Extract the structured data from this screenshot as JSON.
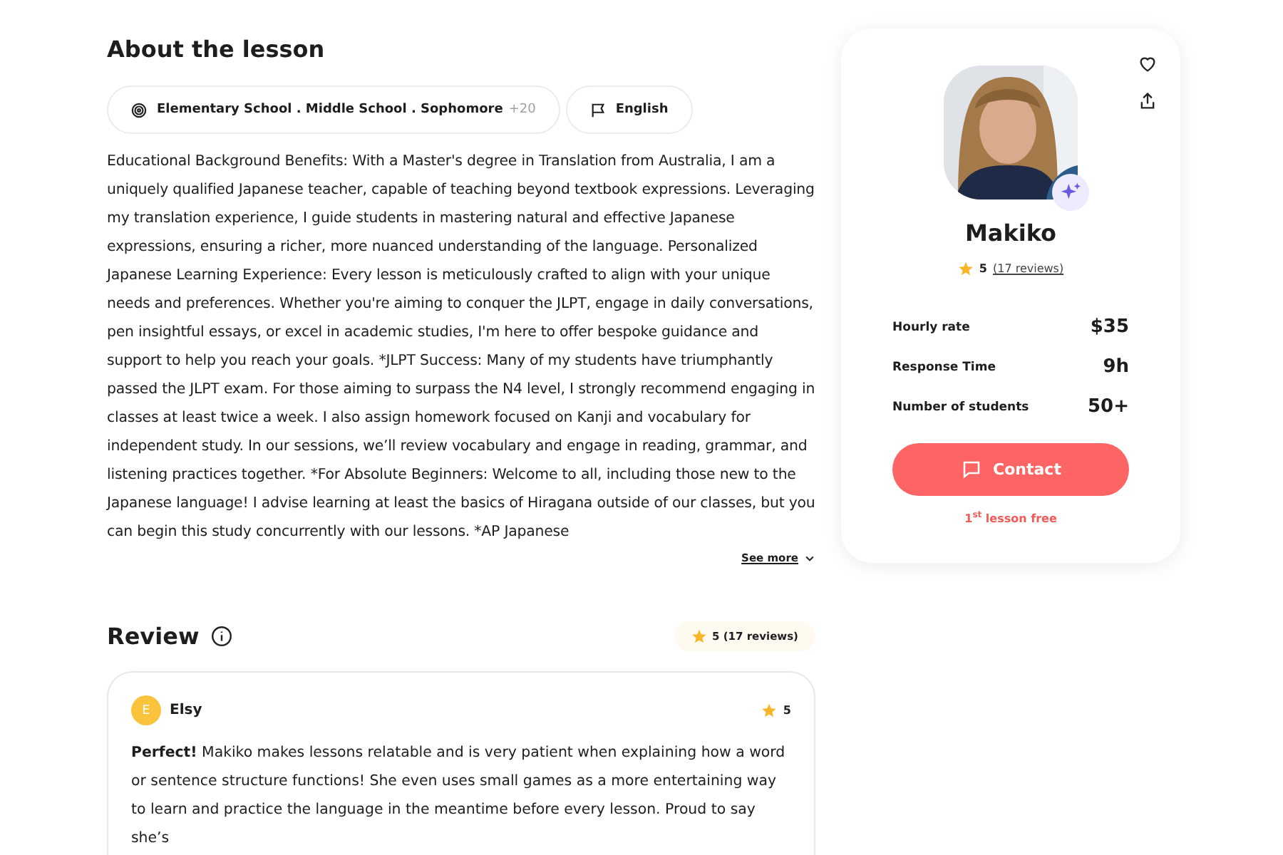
{
  "about": {
    "title": "About the lesson",
    "tags": [
      {
        "kind": "levels",
        "label": "Elementary School . Middle School . Sophomore",
        "extra": "+20"
      },
      {
        "kind": "language",
        "label": "English"
      }
    ],
    "description": "Educational Background Benefits: With a Master's degree in Translation from Australia, I am a uniquely qualified Japanese teacher, capable of teaching beyond textbook expressions. Leveraging my translation experience, I guide students in mastering natural and effective Japanese expressions, ensuring a richer, more nuanced understanding of the language. Personalized Japanese Learning Experience: Every lesson is meticulously crafted to align with your unique needs and preferences. Whether you're aiming to conquer the JLPT, engage in daily conversations, pen insightful essays, or excel in academic studies, I'm here to offer bespoke guidance and support to help you reach your goals. *JLPT Success: Many of my students have triumphantly passed the JLPT exam. For those aiming to surpass the N4 level, I strongly recommend engaging in classes at least twice a week. I also assign homework focused on Kanji and vocabulary for independent study. In our sessions, we’ll review vocabulary and engage in reading, grammar, and listening practices together. *For Absolute Beginners: Welcome to all, including those new to the Japanese language! I advise learning at least the basics of Hiragana outside of our classes, but you can begin this study concurrently with our lessons. *AP Japanese",
    "see_more": "See more"
  },
  "review": {
    "title": "Review",
    "summary": "5 (17 reviews)",
    "items": [
      {
        "initial": "E",
        "name": "Elsy",
        "rating": "5",
        "text": "**Perfect!** Makiko makes lessons relatable and is very patient when explaining how a word or sentence structure functions! She even uses small games as a more entertaining way to learn and practice the language in the meantime before every lesson. Proud to say she’s"
      }
    ]
  },
  "tutor": {
    "name": "Makiko",
    "rating": "5",
    "reviews_link": "(17 reviews)",
    "stats": [
      {
        "label": "Hourly rate",
        "value": "$35"
      },
      {
        "label": "Response Time",
        "value": "9h"
      },
      {
        "label": "Number of students",
        "value": "50+"
      }
    ],
    "contact": "Contact",
    "free_note": "1$^{st}$ lesson free"
  }
}
